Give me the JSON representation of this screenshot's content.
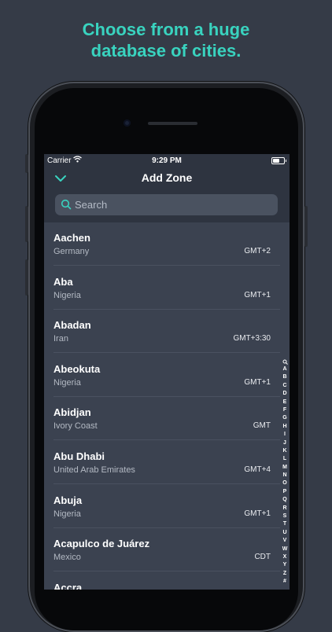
{
  "headline": {
    "line1": "Choose from a huge",
    "line2": "database of cities."
  },
  "status_bar": {
    "carrier": "Carrier",
    "time": "9:29 PM"
  },
  "nav": {
    "title": "Add Zone",
    "back_icon": "chevron-down-icon"
  },
  "search": {
    "placeholder": "Search",
    "icon": "search-icon"
  },
  "zones": [
    {
      "city": "Aachen",
      "country": "Germany",
      "offset": "GMT+2"
    },
    {
      "city": "Aba",
      "country": "Nigeria",
      "offset": "GMT+1"
    },
    {
      "city": "Abadan",
      "country": "Iran",
      "offset": "GMT+3:30"
    },
    {
      "city": "Abeokuta",
      "country": "Nigeria",
      "offset": "GMT+1"
    },
    {
      "city": "Abidjan",
      "country": "Ivory Coast",
      "offset": "GMT"
    },
    {
      "city": "Abu Dhabi",
      "country": "United Arab Emirates",
      "offset": "GMT+4"
    },
    {
      "city": "Abuja",
      "country": "Nigeria",
      "offset": "GMT+1"
    },
    {
      "city": "Acapulco de Juárez",
      "country": "Mexico",
      "offset": "CDT"
    },
    {
      "city": "Accra",
      "country": "",
      "offset": ""
    }
  ],
  "index_letters": [
    "A",
    "B",
    "C",
    "D",
    "E",
    "F",
    "G",
    "H",
    "I",
    "J",
    "K",
    "L",
    "M",
    "N",
    "O",
    "P",
    "Q",
    "R",
    "S",
    "T",
    "U",
    "V",
    "W",
    "X",
    "Y",
    "Z",
    "#"
  ],
  "colors": {
    "accent": "#39d3bf",
    "background": "#353b47",
    "list_background": "#3b4250"
  }
}
